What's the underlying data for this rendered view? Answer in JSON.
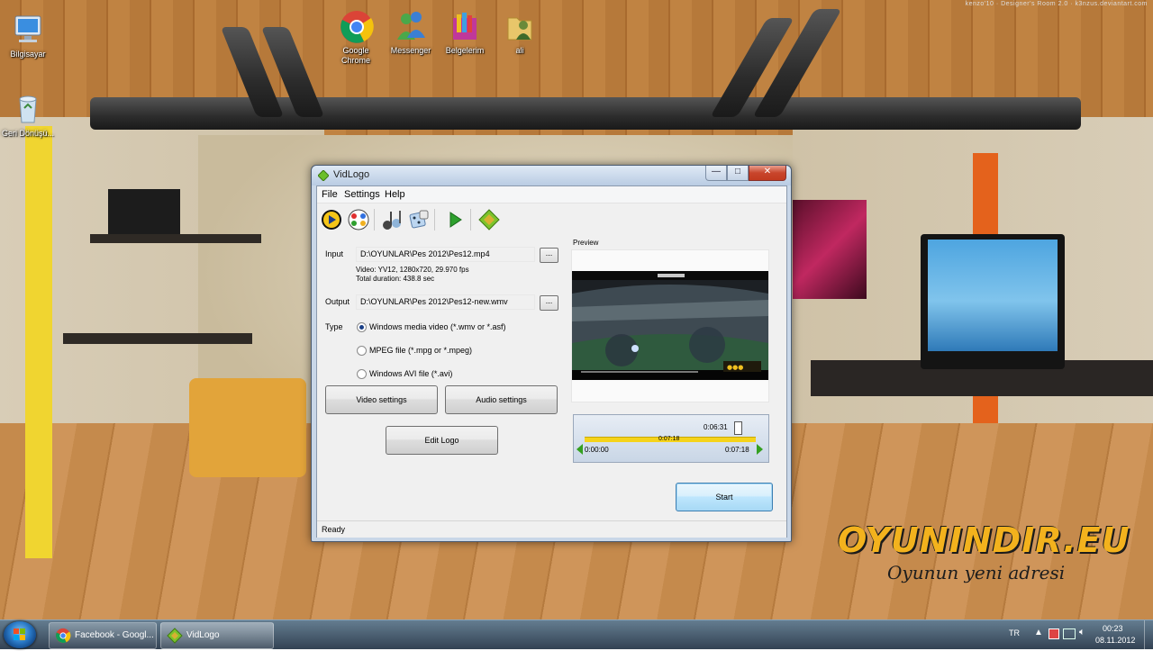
{
  "desktop": {
    "credit": "kenzo'10 · Designer's Room 2.0 · k3nzus.deviantart.com",
    "icons": [
      {
        "label": "Bilgisayar"
      },
      {
        "label": "Geri Dönüşü..."
      },
      {
        "label": "Google Chrome"
      },
      {
        "label": "Messenger"
      },
      {
        "label": "Belgelerim"
      },
      {
        "label": "ali"
      }
    ],
    "watermark_site": "OYUNINDIR.EU",
    "watermark_slogan": "Oyunun yeni adresi"
  },
  "window": {
    "title": "VidLogo",
    "menu": [
      "File",
      "Settings",
      "Help"
    ],
    "toolbar_icons": [
      "play-icon",
      "film-reel-icon",
      "music-icon",
      "dice-icon",
      "start-arrow-icon",
      "logo-icon"
    ],
    "input": {
      "label": "Input",
      "value": "D:\\OYUNLAR\\Pes 2012\\Pes12.mp4",
      "browse": "...",
      "info_line1": "Video: YV12, 1280x720, 29.970 fps",
      "info_line2": "Total duration: 438.8 sec"
    },
    "output": {
      "label": "Output",
      "value": "D:\\OYUNLAR\\Pes 2012\\Pes12-new.wmv",
      "browse": "..."
    },
    "type": {
      "label": "Type",
      "options": [
        {
          "label": "Windows media video (*.wmv or *.asf)",
          "selected": true
        },
        {
          "label": "MPEG file (*.mpg or *.mpeg)",
          "selected": false
        },
        {
          "label": "Windows AVI file (*.avi)",
          "selected": false
        }
      ]
    },
    "buttons": {
      "video_settings": "Video settings",
      "audio_settings": "Audio settings",
      "edit_logo": "Edit Logo",
      "start": "Start"
    },
    "preview": {
      "label": "Preview",
      "current_time": "0:06:31",
      "selection_length": "0:07:18",
      "range_start": "0:00:00",
      "range_end": "0:07:18",
      "position_fraction": 0.89
    },
    "status": "Ready"
  },
  "taskbar": {
    "tasks": [
      {
        "label": "Facebook - Googl..."
      },
      {
        "label": "VidLogo"
      }
    ],
    "language": "TR",
    "time": "00:23",
    "date": "08.11.2012"
  }
}
